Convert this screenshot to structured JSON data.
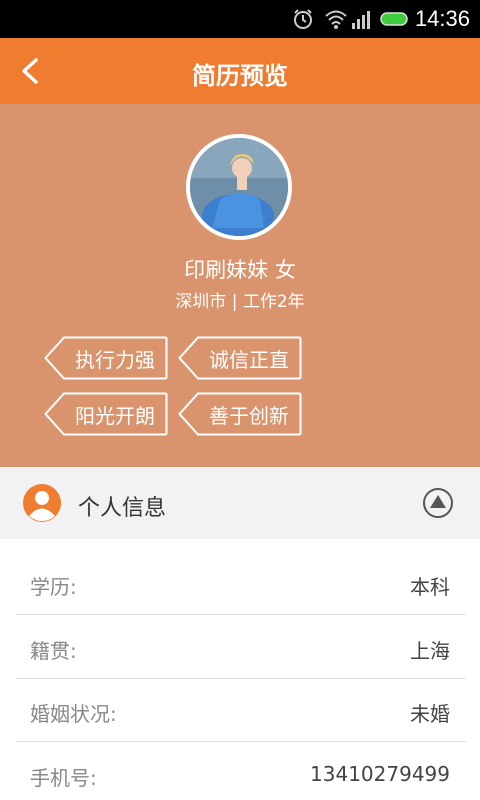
{
  "status_bar": {
    "time": "14:36"
  },
  "header": {
    "title": "简历预览"
  },
  "profile": {
    "name_gender": "印刷妹妹 女",
    "location_experience": "深圳市 | 工作2年",
    "tags": [
      "执行力强",
      "诚信正直",
      "阳光开朗",
      "善于创新"
    ]
  },
  "section": {
    "title": "个人信息"
  },
  "info_rows": [
    {
      "label": "学历:",
      "value": "本科"
    },
    {
      "label": "籍贯:",
      "value": "上海"
    },
    {
      "label": "婚姻状况:",
      "value": "未婚"
    },
    {
      "label": "手机号:",
      "value": "13410279499"
    }
  ],
  "colors": {
    "accent": "#f07c30",
    "header_bg": "#d9946d",
    "section_bg": "#f2f2f2"
  }
}
